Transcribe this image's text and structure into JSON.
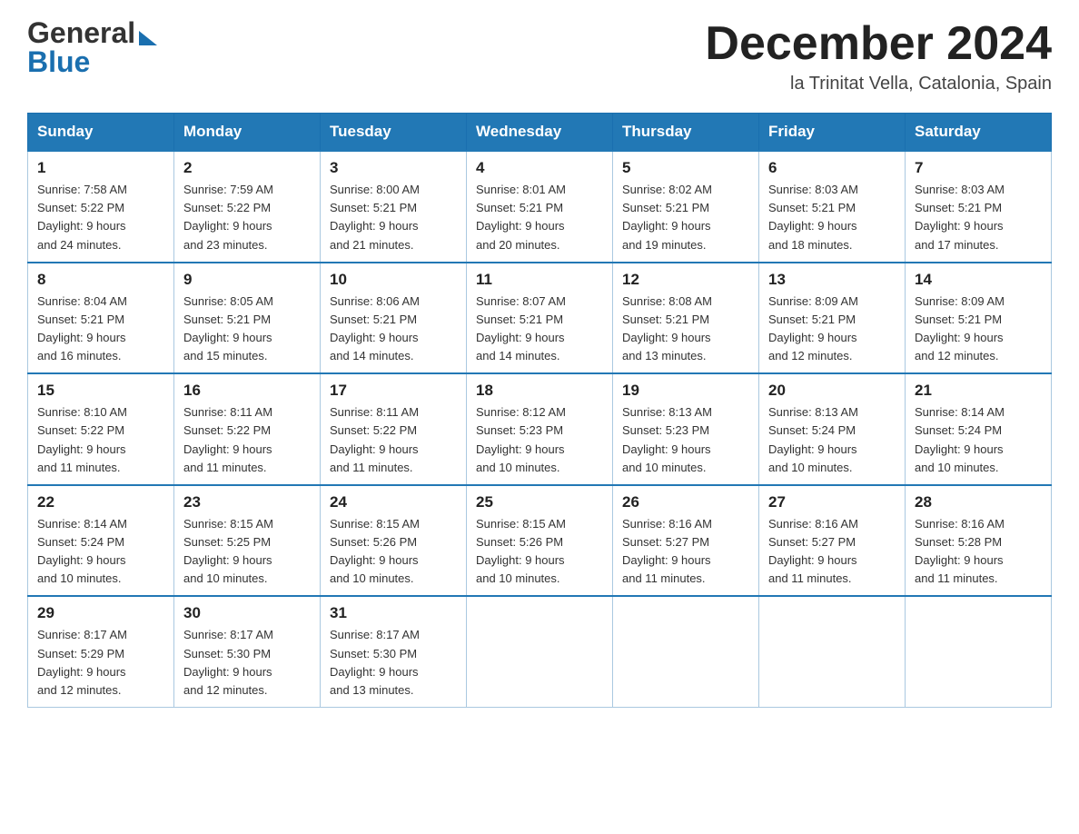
{
  "header": {
    "logo_line1": "General",
    "logo_line2": "Blue",
    "month_title": "December 2024",
    "location": "la Trinitat Vella, Catalonia, Spain"
  },
  "days_of_week": [
    "Sunday",
    "Monday",
    "Tuesday",
    "Wednesday",
    "Thursday",
    "Friday",
    "Saturday"
  ],
  "weeks": [
    [
      {
        "day": "1",
        "sunrise": "7:58 AM",
        "sunset": "5:22 PM",
        "daylight": "9 hours and 24 minutes."
      },
      {
        "day": "2",
        "sunrise": "7:59 AM",
        "sunset": "5:22 PM",
        "daylight": "9 hours and 23 minutes."
      },
      {
        "day": "3",
        "sunrise": "8:00 AM",
        "sunset": "5:21 PM",
        "daylight": "9 hours and 21 minutes."
      },
      {
        "day": "4",
        "sunrise": "8:01 AM",
        "sunset": "5:21 PM",
        "daylight": "9 hours and 20 minutes."
      },
      {
        "day": "5",
        "sunrise": "8:02 AM",
        "sunset": "5:21 PM",
        "daylight": "9 hours and 19 minutes."
      },
      {
        "day": "6",
        "sunrise": "8:03 AM",
        "sunset": "5:21 PM",
        "daylight": "9 hours and 18 minutes."
      },
      {
        "day": "7",
        "sunrise": "8:03 AM",
        "sunset": "5:21 PM",
        "daylight": "9 hours and 17 minutes."
      }
    ],
    [
      {
        "day": "8",
        "sunrise": "8:04 AM",
        "sunset": "5:21 PM",
        "daylight": "9 hours and 16 minutes."
      },
      {
        "day": "9",
        "sunrise": "8:05 AM",
        "sunset": "5:21 PM",
        "daylight": "9 hours and 15 minutes."
      },
      {
        "day": "10",
        "sunrise": "8:06 AM",
        "sunset": "5:21 PM",
        "daylight": "9 hours and 14 minutes."
      },
      {
        "day": "11",
        "sunrise": "8:07 AM",
        "sunset": "5:21 PM",
        "daylight": "9 hours and 14 minutes."
      },
      {
        "day": "12",
        "sunrise": "8:08 AM",
        "sunset": "5:21 PM",
        "daylight": "9 hours and 13 minutes."
      },
      {
        "day": "13",
        "sunrise": "8:09 AM",
        "sunset": "5:21 PM",
        "daylight": "9 hours and 12 minutes."
      },
      {
        "day": "14",
        "sunrise": "8:09 AM",
        "sunset": "5:21 PM",
        "daylight": "9 hours and 12 minutes."
      }
    ],
    [
      {
        "day": "15",
        "sunrise": "8:10 AM",
        "sunset": "5:22 PM",
        "daylight": "9 hours and 11 minutes."
      },
      {
        "day": "16",
        "sunrise": "8:11 AM",
        "sunset": "5:22 PM",
        "daylight": "9 hours and 11 minutes."
      },
      {
        "day": "17",
        "sunrise": "8:11 AM",
        "sunset": "5:22 PM",
        "daylight": "9 hours and 11 minutes."
      },
      {
        "day": "18",
        "sunrise": "8:12 AM",
        "sunset": "5:23 PM",
        "daylight": "9 hours and 10 minutes."
      },
      {
        "day": "19",
        "sunrise": "8:13 AM",
        "sunset": "5:23 PM",
        "daylight": "9 hours and 10 minutes."
      },
      {
        "day": "20",
        "sunrise": "8:13 AM",
        "sunset": "5:24 PM",
        "daylight": "9 hours and 10 minutes."
      },
      {
        "day": "21",
        "sunrise": "8:14 AM",
        "sunset": "5:24 PM",
        "daylight": "9 hours and 10 minutes."
      }
    ],
    [
      {
        "day": "22",
        "sunrise": "8:14 AM",
        "sunset": "5:24 PM",
        "daylight": "9 hours and 10 minutes."
      },
      {
        "day": "23",
        "sunrise": "8:15 AM",
        "sunset": "5:25 PM",
        "daylight": "9 hours and 10 minutes."
      },
      {
        "day": "24",
        "sunrise": "8:15 AM",
        "sunset": "5:26 PM",
        "daylight": "9 hours and 10 minutes."
      },
      {
        "day": "25",
        "sunrise": "8:15 AM",
        "sunset": "5:26 PM",
        "daylight": "9 hours and 10 minutes."
      },
      {
        "day": "26",
        "sunrise": "8:16 AM",
        "sunset": "5:27 PM",
        "daylight": "9 hours and 11 minutes."
      },
      {
        "day": "27",
        "sunrise": "8:16 AM",
        "sunset": "5:27 PM",
        "daylight": "9 hours and 11 minutes."
      },
      {
        "day": "28",
        "sunrise": "8:16 AM",
        "sunset": "5:28 PM",
        "daylight": "9 hours and 11 minutes."
      }
    ],
    [
      {
        "day": "29",
        "sunrise": "8:17 AM",
        "sunset": "5:29 PM",
        "daylight": "9 hours and 12 minutes."
      },
      {
        "day": "30",
        "sunrise": "8:17 AM",
        "sunset": "5:30 PM",
        "daylight": "9 hours and 12 minutes."
      },
      {
        "day": "31",
        "sunrise": "8:17 AM",
        "sunset": "5:30 PM",
        "daylight": "9 hours and 13 minutes."
      },
      null,
      null,
      null,
      null
    ]
  ],
  "labels": {
    "sunrise": "Sunrise:",
    "sunset": "Sunset:",
    "daylight": "Daylight:"
  }
}
